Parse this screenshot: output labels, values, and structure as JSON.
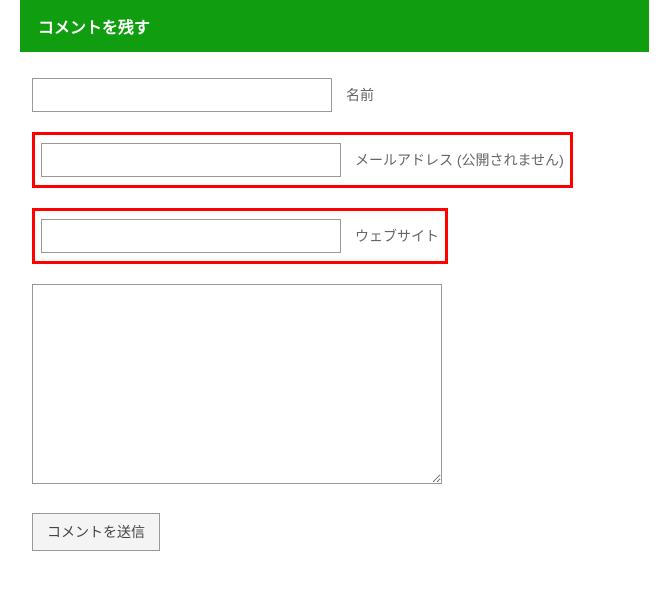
{
  "header": {
    "title": "コメントを残す"
  },
  "form": {
    "name": {
      "label": "名前",
      "value": ""
    },
    "email": {
      "label": "メールアドレス (公開されません)",
      "value": ""
    },
    "website": {
      "label": "ウェブサイト",
      "value": ""
    },
    "comment": {
      "value": ""
    },
    "submit": {
      "label": "コメントを送信"
    }
  },
  "highlights": [
    "email",
    "website"
  ]
}
